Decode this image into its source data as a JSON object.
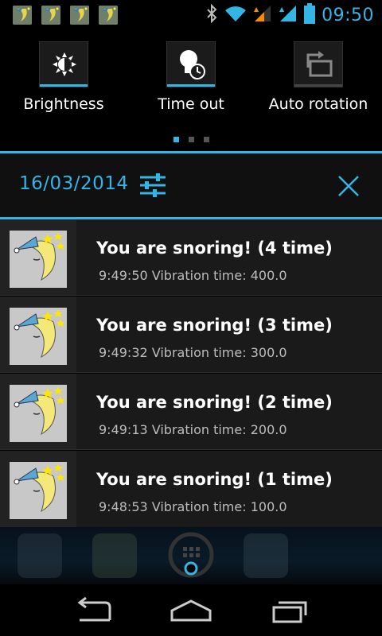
{
  "status_bar": {
    "time": "09:50",
    "icons": [
      "snore-notification-icon",
      "snore-notification-icon",
      "snore-notification-icon",
      "snore-notification-icon",
      "bluetooth-icon",
      "wifi-icon",
      "cell-signal-icon",
      "cell-signal-icon",
      "battery-icon"
    ]
  },
  "quick_settings": {
    "tiles": [
      {
        "label": "Brightness",
        "icon": "brightness-icon",
        "active": true
      },
      {
        "label": "Time out",
        "icon": "timeout-icon",
        "active": true
      },
      {
        "label": "Auto rotation",
        "icon": "auto-rotation-icon",
        "active": false
      }
    ],
    "page_indicator": {
      "pages": 3,
      "current": 1
    }
  },
  "notification_header": {
    "date": "16/03/2014",
    "settings_icon": "settings-sliders-icon",
    "clear_icon": "close-icon"
  },
  "notifications": [
    {
      "title": "You are snoring! (4 time)",
      "subtitle": "9:49:50 Vibration time: 400.0",
      "icon": "sleeping-moon-icon"
    },
    {
      "title": "You are snoring! (3 time)",
      "subtitle": "9:49:32 Vibration time: 300.0",
      "icon": "sleeping-moon-icon"
    },
    {
      "title": "You are snoring! (2 time)",
      "subtitle": "9:49:13 Vibration time: 200.0",
      "icon": "sleeping-moon-icon"
    },
    {
      "title": "You are snoring! (1 time)",
      "subtitle": "9:48:53 Vibration time: 100.0",
      "icon": "sleeping-moon-icon"
    }
  ],
  "nav_bar": {
    "buttons": [
      "back-icon",
      "home-icon",
      "recents-icon"
    ]
  },
  "colors": {
    "accent": "#33b5e5",
    "background": "#000000",
    "notification_bg": "#1a1a1a"
  }
}
